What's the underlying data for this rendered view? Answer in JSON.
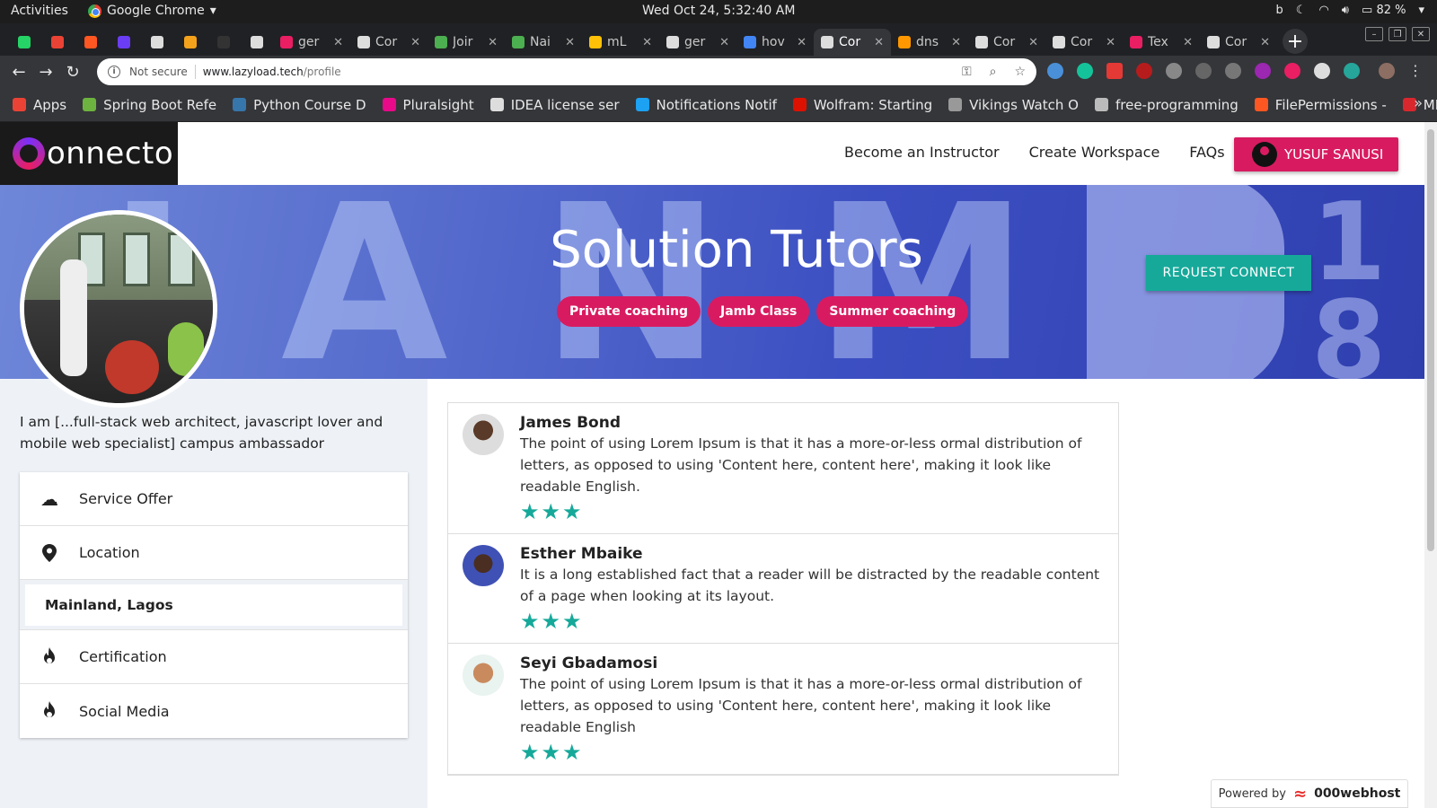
{
  "system": {
    "activities": "Activities",
    "app_name": "Google Chrome",
    "clock": "Wed Oct 24,  5:32:40 AM",
    "battery": "82 %"
  },
  "tabs": [
    {
      "title": "",
      "color": "#25d366",
      "pinned": true
    },
    {
      "title": "",
      "color": "#ea4335",
      "pinned": true
    },
    {
      "title": "",
      "color": "#ff5722",
      "pinned": true
    },
    {
      "title": "",
      "color": "#6b3df5",
      "pinned": true
    },
    {
      "title": "",
      "color": "#dddddd",
      "pinned": true
    },
    {
      "title": "",
      "color": "#f4a21c",
      "pinned": true
    },
    {
      "title": "",
      "color": "#333333",
      "pinned": true
    },
    {
      "title": "",
      "color": "#dddddd",
      "pinned": true
    },
    {
      "title": "ger",
      "color": "#e91e63"
    },
    {
      "title": "Cor",
      "color": "#dddddd"
    },
    {
      "title": "Joir",
      "color": "#4caf50"
    },
    {
      "title": "Nai",
      "color": "#4caf50"
    },
    {
      "title": "mL",
      "color": "#ffc107"
    },
    {
      "title": "ger",
      "color": "#dddddd"
    },
    {
      "title": "hov",
      "color": "#4285f4"
    },
    {
      "title": "Cor",
      "color": "#dddddd",
      "active": true
    },
    {
      "title": "dns",
      "color": "#ff9800"
    },
    {
      "title": "Cor",
      "color": "#dddddd"
    },
    {
      "title": "Cor",
      "color": "#dddddd"
    },
    {
      "title": "Tex",
      "color": "#e91e63"
    },
    {
      "title": "Cor",
      "color": "#dddddd"
    }
  ],
  "address": {
    "security": "Not secure",
    "host": "www.lazyload.tech",
    "path": "/profile"
  },
  "bookmarks": [
    {
      "label": "Apps",
      "color": "#ea4335"
    },
    {
      "label": "Spring Boot Refe",
      "color": "#6db33f"
    },
    {
      "label": "Python Course D",
      "color": "#3776ab"
    },
    {
      "label": "Pluralsight",
      "color": "#e80a89"
    },
    {
      "label": "IDEA license ser",
      "color": "#dddddd"
    },
    {
      "label": "Notifications Notif",
      "color": "#1da1f2"
    },
    {
      "label": "Wolfram: Starting",
      "color": "#dd1100"
    },
    {
      "label": "Vikings Watch O",
      "color": "#999999"
    },
    {
      "label": "free-programming",
      "color": "#bbbbbb"
    },
    {
      "label": "FilePermissions -",
      "color": "#ff5722"
    },
    {
      "label": "MEGA",
      "color": "#d9272e"
    }
  ],
  "site": {
    "logo": "onnecto",
    "nav": [
      "Become an Instructor",
      "Create Workspace",
      "FAQs"
    ],
    "user": "YUSUF SANUSI",
    "hero_title": "Solution Tutors",
    "tags": [
      "Private coaching",
      "Jamb Class",
      "Summer coaching"
    ],
    "request_label": "REQUEST CONNECT",
    "bio": "I am [...full-stack web architect, javascript lover and mobile web specialist] campus ambassador",
    "menu": {
      "service": "Service Offer",
      "location": "Location",
      "location_value": "Mainland, Lagos",
      "cert": "Certification",
      "social": "Social Media"
    },
    "reviews": [
      {
        "name": "James Bond",
        "text": "The point of using Lorem Ipsum is that it has a more-or-less ormal distribution of letters, as opposed to using 'Content here, content here', making it look like readable English.",
        "rating": 3
      },
      {
        "name": "Esther Mbaike",
        "text": "It is a long established fact that a reader will be distracted by the readable content of a page when looking at its layout.",
        "rating": 3
      },
      {
        "name": "Seyi Gbadamosi",
        "text": "The point of using Lorem Ipsum is that it has a more-or-less ormal distribution of letters, as opposed to using 'Content here, content here', making it look like readable English",
        "rating": 3
      }
    ],
    "powered": {
      "label": "Powered by",
      "brand": "000webhost"
    }
  }
}
